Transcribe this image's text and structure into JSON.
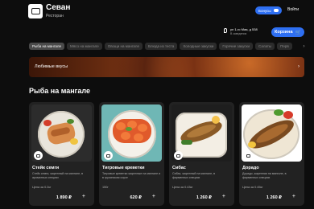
{
  "header": {
    "brand": "Севан",
    "subtitle": "Ресторан",
    "bonus_label": "Бонусы",
    "login_label": "Войти"
  },
  "delivery": {
    "address": "ул 1-го Мая, д 538",
    "mode": "В заведении"
  },
  "cart": {
    "label": "Корзина"
  },
  "tabs": [
    {
      "label": "Рыба на мангале",
      "active": true
    },
    {
      "label": "Мясо на мангале"
    },
    {
      "label": "Овощи на мангале"
    },
    {
      "label": "Блюда из теста"
    },
    {
      "label": "Холодные закуски"
    },
    {
      "label": "Горячие закуски"
    },
    {
      "label": "Салаты"
    },
    {
      "label": "Перв"
    }
  ],
  "banner": {
    "title": "Любимые вкусы"
  },
  "section": {
    "title": "Рыба на мангале"
  },
  "products": [
    {
      "name": "Стейк семги",
      "desc": "Стейк семги, жаренный на мангале, в ароматных специях",
      "weight": "Цена за 0.2кг",
      "price": "1 890 ₽"
    },
    {
      "name": "Тигровые креветки",
      "desc": "Тигровые креветки жаренные на мангале и в грузинском соусе",
      "weight": "150г",
      "price": "620 ₽"
    },
    {
      "name": "Сибас",
      "desc": "Сибас, жаренный на мангале, в фирменных специях",
      "weight": "Цена за 0.43кг",
      "price": "1 260 ₽"
    },
    {
      "name": "Дорадо",
      "desc": "Дорадо, жаренная на мангале, в фирменных специях",
      "weight": "Цена за 0.45кг",
      "price": "1 260 ₽"
    }
  ],
  "colors": {
    "accent": "#2e6ff2",
    "background": "#0d0d0d",
    "card": "#222222"
  }
}
